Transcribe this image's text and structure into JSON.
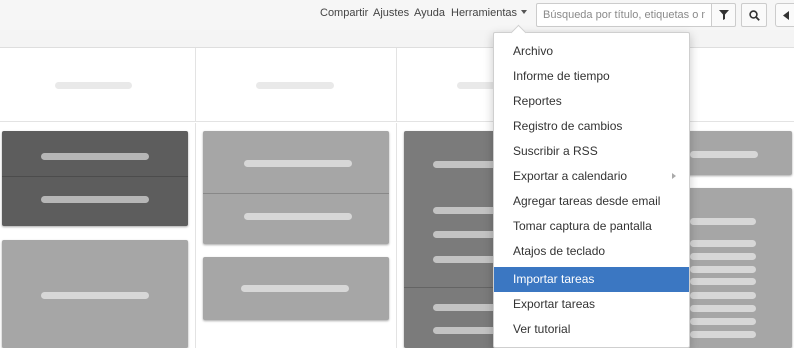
{
  "topbar": {
    "share": "Compartir",
    "settings": "Ajustes",
    "help": "Ayuda",
    "tools": "Herramientas",
    "search_placeholder": "Búsqueda por título, etiquetas o no"
  },
  "tools_menu": {
    "items": [
      {
        "label": "Archivo"
      },
      {
        "label": "Informe de tiempo"
      },
      {
        "label": "Reportes"
      },
      {
        "label": "Registro de cambios"
      },
      {
        "label": "Suscribir a RSS"
      },
      {
        "label": "Exportar a calendario",
        "has_submenu": true
      },
      {
        "label": "Agregar tareas desde email"
      },
      {
        "label": "Tomar captura de pantalla"
      },
      {
        "label": "Atajos de teclado"
      },
      {
        "label": "Importar tareas",
        "highlighted": true
      },
      {
        "label": "Exportar tareas"
      },
      {
        "label": "Ver tutorial"
      }
    ],
    "highlight_color": "#3b77c2"
  },
  "icons": [
    "caret-down-icon",
    "filter-icon",
    "search-icon",
    "collapse-arrow-icon",
    "submenu-arrow-icon"
  ]
}
